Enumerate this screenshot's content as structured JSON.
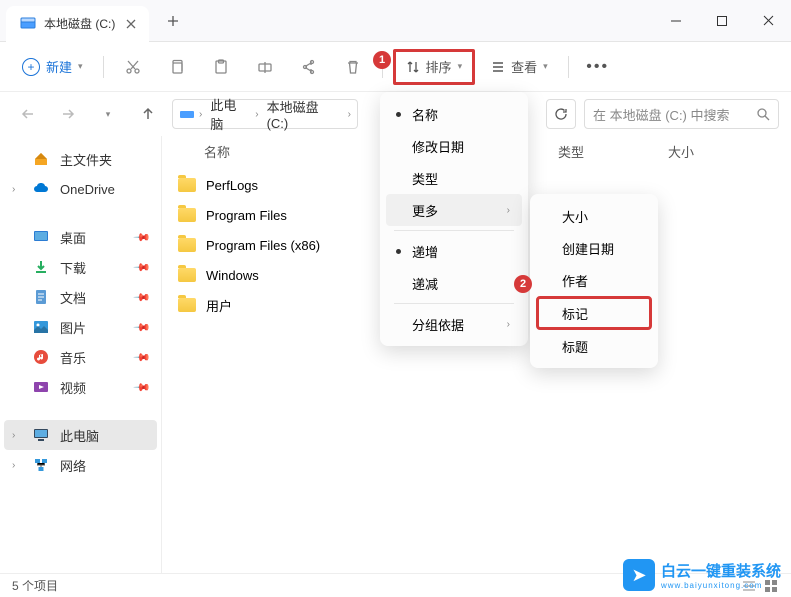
{
  "tab": {
    "title": "本地磁盘 (C:)"
  },
  "toolbar": {
    "new_label": "新建",
    "sort_label": "排序",
    "view_label": "查看"
  },
  "breadcrumb": {
    "items": [
      "此电脑",
      "本地磁盘 (C:)"
    ]
  },
  "search": {
    "placeholder": "在 本地磁盘 (C:) 中搜索"
  },
  "columns": {
    "name": "名称",
    "type": "类型",
    "size": "大小"
  },
  "sidebar": {
    "home": "主文件夹",
    "onedrive": "OneDrive",
    "desktop": "桌面",
    "downloads": "下载",
    "documents": "文档",
    "pictures": "图片",
    "music": "音乐",
    "videos": "视频",
    "this_pc": "此电脑",
    "network": "网络"
  },
  "files": {
    "items": [
      "PerfLogs",
      "Program Files",
      "Program Files (x86)",
      "Windows",
      "用户"
    ]
  },
  "menu1": {
    "name": "名称",
    "modified": "修改日期",
    "type": "类型",
    "more": "更多",
    "asc": "递增",
    "desc": "递减",
    "groupby": "分组依据"
  },
  "menu2": {
    "size": "大小",
    "created": "创建日期",
    "author": "作者",
    "tag": "标记",
    "title_": "标题"
  },
  "status": {
    "count": "5 个项目"
  },
  "badge": {
    "one": "1",
    "two": "2"
  },
  "watermark": {
    "text": "白云一键重装系统",
    "sub": "www.baiyunxitong.com"
  }
}
